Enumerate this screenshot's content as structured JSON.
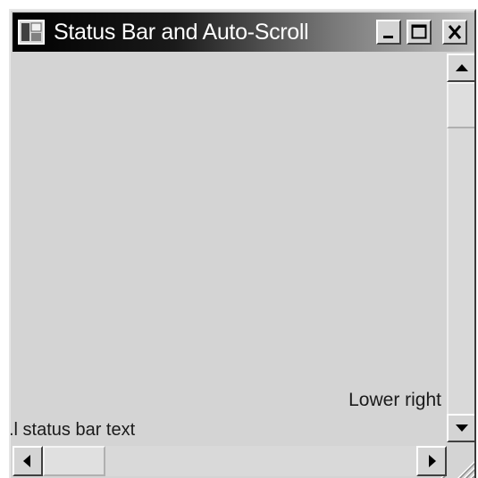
{
  "window": {
    "title": "Status Bar and Auto-Scroll",
    "app_icon": "application-window-icon"
  },
  "caption_buttons": {
    "minimize_icon": "minimize-icon",
    "maximize_icon": "maximize-icon",
    "close_icon": "close-icon"
  },
  "client": {
    "lower_right_text": "Lower right"
  },
  "status_bar": {
    "text": ".l status bar text"
  },
  "scrollbars": {
    "vertical": {
      "position_fraction": 0.0,
      "up_icon": "arrow-up-icon",
      "down_icon": "arrow-down-icon"
    },
    "horizontal": {
      "position_fraction": 0.0,
      "left_icon": "arrow-left-icon",
      "right_icon": "arrow-right-icon"
    },
    "size_grip_icon": "size-grip-icon"
  },
  "colors": {
    "face": "#d4d4d4",
    "title_start": "#000000",
    "title_end": "#bdbdbd",
    "title_text": "#ffffff",
    "text": "#1a1a1a"
  }
}
